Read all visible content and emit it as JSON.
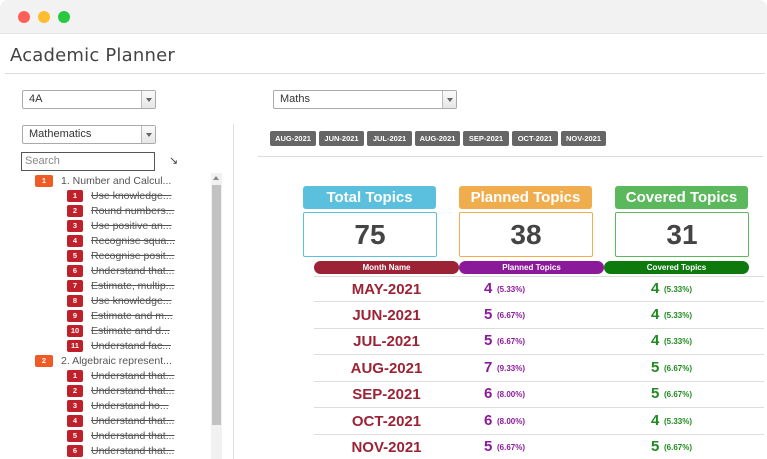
{
  "app": {
    "title": "Academic Planner"
  },
  "filters": {
    "class": "4A",
    "subject_left": "Mathematics",
    "subject_right": "Maths",
    "search_placeholder": "Search"
  },
  "tree": {
    "topics": [
      {
        "num": "1",
        "label": "1. Number and Calcul...",
        "subs": [
          {
            "num": "1",
            "label": "Use knowledge..."
          },
          {
            "num": "2",
            "label": "Round numbers..."
          },
          {
            "num": "3",
            "label": "Use positive an..."
          },
          {
            "num": "4",
            "label": "Recognise squa..."
          },
          {
            "num": "5",
            "label": "Recognise posit..."
          },
          {
            "num": "6",
            "label": "Understand that..."
          },
          {
            "num": "7",
            "label": "Estimate, multip..."
          },
          {
            "num": "8",
            "label": "Use knowledge..."
          },
          {
            "num": "9",
            "label": "Estimate and m..."
          },
          {
            "num": "10",
            "label": "Estimate and d..."
          },
          {
            "num": "11",
            "label": "Understand fac..."
          }
        ]
      },
      {
        "num": "2",
        "label": "2. Algebraic represent...",
        "subs": [
          {
            "num": "1",
            "label": "Understand that..."
          },
          {
            "num": "2",
            "label": "Understand that..."
          },
          {
            "num": "3",
            "label": "Understand ho..."
          },
          {
            "num": "4",
            "label": "Understand that..."
          },
          {
            "num": "5",
            "label": "Understand that..."
          },
          {
            "num": "6",
            "label": "Understand that..."
          }
        ]
      }
    ]
  },
  "months": [
    "AUG-2021",
    "JUN-2021",
    "JUL-2021",
    "AUG-2021",
    "SEP-2021",
    "OCT-2021",
    "NOV-2021"
  ],
  "summary": {
    "total": {
      "label": "Total Topics",
      "value": "75",
      "color": "#5bc0de"
    },
    "planned": {
      "label": "Planned Topics",
      "value": "38",
      "color": "#f0ad4e"
    },
    "covered": {
      "label": "Covered Topics",
      "value": "31",
      "color": "#5cb85c"
    }
  },
  "table": {
    "headers": {
      "month": "Month Name",
      "planned": "Planned Topics",
      "covered": "Covered Topics"
    },
    "header_colors": {
      "month": "#9b2335",
      "planned": "#8b1a9b",
      "covered": "#0e7a0e"
    },
    "rows": [
      {
        "month": "MAY-2021",
        "planned": "4",
        "planned_pct": "(5.33%)",
        "covered": "4",
        "covered_pct": "(5.33%)"
      },
      {
        "month": "JUN-2021",
        "planned": "5",
        "planned_pct": "(6.67%)",
        "covered": "4",
        "covered_pct": "(5.33%)"
      },
      {
        "month": "JUL-2021",
        "planned": "5",
        "planned_pct": "(6.67%)",
        "covered": "4",
        "covered_pct": "(5.33%)"
      },
      {
        "month": "AUG-2021",
        "planned": "7",
        "planned_pct": "(9.33%)",
        "covered": "5",
        "covered_pct": "(6.67%)"
      },
      {
        "month": "SEP-2021",
        "planned": "6",
        "planned_pct": "(8.00%)",
        "covered": "5",
        "covered_pct": "(6.67%)"
      },
      {
        "month": "OCT-2021",
        "planned": "6",
        "planned_pct": "(8.00%)",
        "covered": "4",
        "covered_pct": "(5.33%)"
      },
      {
        "month": "NOV-2021",
        "planned": "5",
        "planned_pct": "(6.67%)",
        "covered": "5",
        "covered_pct": "(6.67%)"
      }
    ]
  }
}
